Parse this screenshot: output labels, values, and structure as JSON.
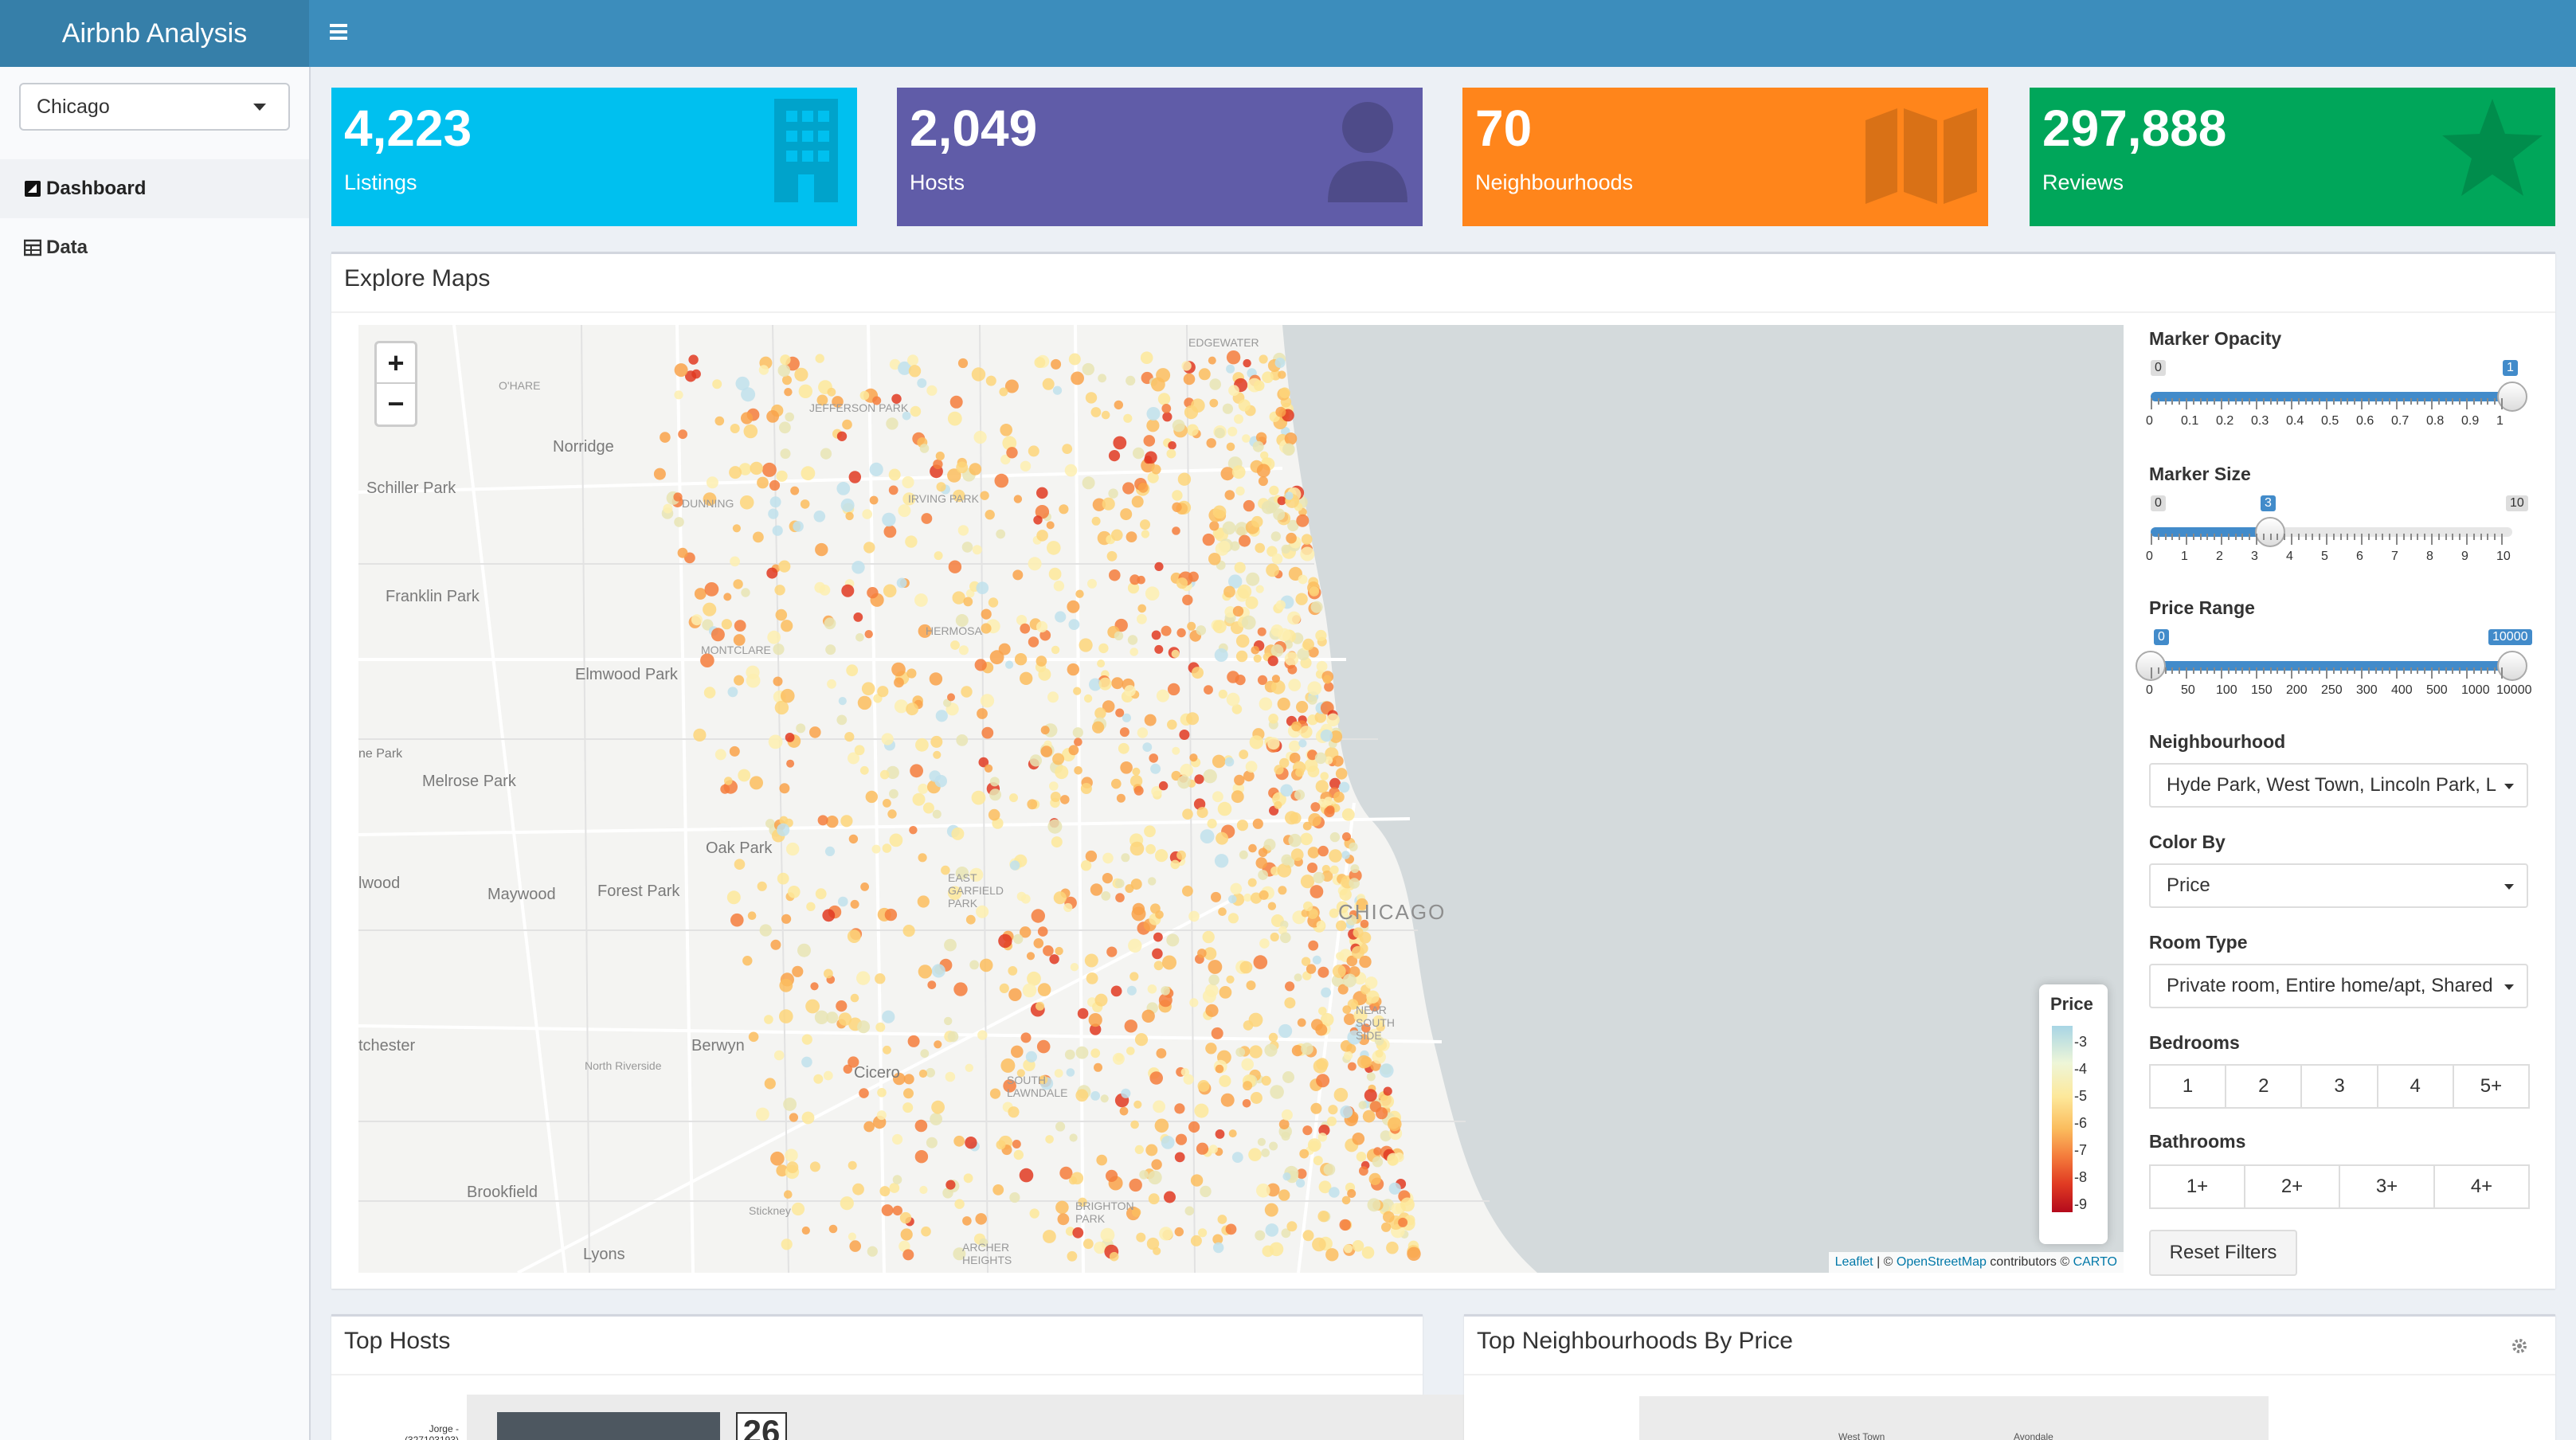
{
  "app": {
    "title": "Airbnb Analysis"
  },
  "sidebar": {
    "city": "Chicago",
    "items": [
      {
        "label": "Dashboard",
        "icon": "dashboard-icon"
      },
      {
        "label": "Data",
        "icon": "table-icon"
      }
    ]
  },
  "stats": [
    {
      "value": "4,223",
      "label": "Listings",
      "color": "#00c0ef",
      "icon": "building-icon"
    },
    {
      "value": "2,049",
      "label": "Hosts",
      "color": "#605ca8",
      "icon": "user-icon"
    },
    {
      "value": "70",
      "label": "Neighbourhoods",
      "color": "#ff851b",
      "icon": "map-icon"
    },
    {
      "value": "297,888",
      "label": "Reviews",
      "color": "#00a65a",
      "icon": "star-icon"
    }
  ],
  "explore": {
    "title": "Explore Maps",
    "map": {
      "places": [
        "O'HARE",
        "Norridge",
        "Schiller Park",
        "DUNNING",
        "Franklin Park",
        "MONTCLARE",
        "Elmwood Park",
        "Melrose Park",
        "Oak Park",
        "Maywood",
        "Forest Park",
        "Berwyn",
        "North Riverside",
        "Cicero",
        "Brookfield",
        "Lyons",
        "Stickney",
        "CHICAGO",
        "IRVING PARK",
        "JEFFERSON PARK",
        "HERMOSA",
        "EAST GARFIELD PARK",
        "SOUTH LAWNDALE",
        "BRIGHTON PARK",
        "ARCHER HEIGHTS",
        "EDGEWATER",
        "NEAR SOUTH SIDE",
        "ne Park",
        "lwood",
        "tchester"
      ],
      "attribution": {
        "leaflet": "Leaflet",
        "sep": " | © ",
        "osm": "OpenStreetMap",
        "contrib": " contributors © ",
        "carto": "CARTO"
      },
      "legend": {
        "title": "Price",
        "ticks": [
          "3",
          "4",
          "5",
          "6",
          "7",
          "8",
          "9"
        ]
      }
    },
    "controls": {
      "opacity": {
        "label": "Marker Opacity",
        "min": "0",
        "value": "1",
        "ticks": [
          "0",
          "0.1",
          "0.2",
          "0.3",
          "0.4",
          "0.5",
          "0.6",
          "0.7",
          "0.8",
          "0.9",
          "1"
        ],
        "fraction": 1.0
      },
      "size": {
        "label": "Marker Size",
        "min": "0",
        "max": "10",
        "value": "3",
        "ticks": [
          "0",
          "1",
          "2",
          "3",
          "4",
          "5",
          "6",
          "7",
          "8",
          "9",
          "10"
        ],
        "fraction": 0.3
      },
      "price": {
        "label": "Price Range",
        "low": "0",
        "high": "10000",
        "ticks": [
          "0",
          "50",
          "100",
          "150",
          "200",
          "250",
          "300",
          "400",
          "500",
          "1000",
          "10000"
        ]
      },
      "neighbourhood": {
        "label": "Neighbourhood",
        "value": "Hyde Park, West Town, Lincoln Park, L"
      },
      "color_by": {
        "label": "Color By",
        "value": "Price"
      },
      "room_type": {
        "label": "Room Type",
        "value": "Private room, Entire home/apt, Shared"
      },
      "bedrooms": {
        "label": "Bedrooms",
        "options": [
          "1",
          "2",
          "3",
          "4",
          "5+"
        ]
      },
      "bathrooms": {
        "label": "Bathrooms",
        "options": [
          "1+",
          "2+",
          "3+",
          "4+"
        ]
      },
      "reset": "Reset Filters"
    }
  },
  "top_hosts": {
    "title": "Top Hosts",
    "first_host": "Jorge -",
    "first_host_id": "(327103193)",
    "first_value": "26"
  },
  "top_neighbourhoods": {
    "title": "Top Neighbourhoods By Price",
    "labels": [
      "West Town",
      "Avondale"
    ]
  }
}
